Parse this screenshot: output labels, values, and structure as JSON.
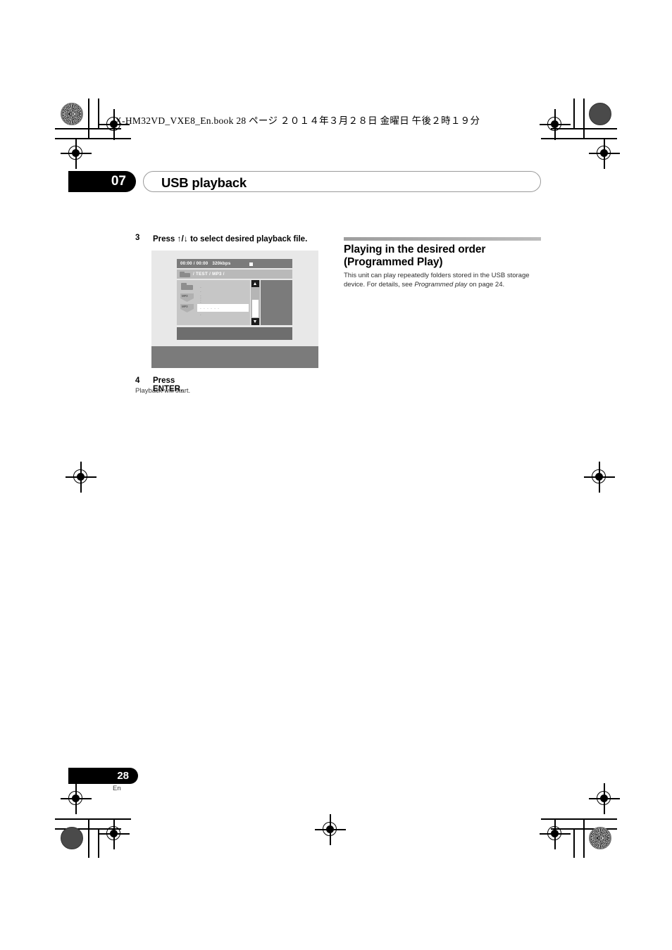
{
  "slug": {
    "text": "X-HM32VD_VXE8_En.book   28 ページ   ２０１４年３月２８日   金曜日   午後２時１９分"
  },
  "header": {
    "chapter_number": "07",
    "chapter_title": "USB playback"
  },
  "steps": [
    {
      "number": "3",
      "text_before": "Press",
      "arrows": "↑/↓",
      "text_after": "to select desired playback file."
    },
    {
      "number": "4",
      "text": "Press ENTER.",
      "caption": "Playback will start."
    }
  ],
  "screenshot": {
    "status_bar": {
      "time": "00:00 / 00:00",
      "bitrate": "320kbps",
      "transport_icon": "stop-icon"
    },
    "path_bar": {
      "folder_icon": "folder-icon",
      "path": "/ TEST /  MP3 /"
    },
    "file_list": [
      {
        "icon": "folder-icon",
        "label": "- - - - -",
        "selected": false
      },
      {
        "icon": "mp3-icon",
        "badge": "MP3",
        "label": "- - - - -",
        "selected": false
      },
      {
        "icon": "mp3-icon",
        "badge": "MP3",
        "label": "- - - - - -",
        "selected": true
      }
    ],
    "scrollbar": {
      "up_icon": "scroll-up-arrow-icon",
      "down_icon": "scroll-down-arrow-icon"
    }
  },
  "section": {
    "heading_line1": "Playing in the desired order",
    "heading_line2": "(Programmed Play)",
    "body_part1": "This unit can play repeatedly folders stored in the USB storage device. For details, see ",
    "body_italic": "Programmed play",
    "body_part2": " on page 24."
  },
  "footer": {
    "page_number": "28",
    "language": "En"
  },
  "colors": {
    "accent_black": "#000000",
    "rule_gray": "#9e9e9e",
    "osd_dark": "#7b7b7b",
    "osd_light": "#c6c6c6"
  }
}
